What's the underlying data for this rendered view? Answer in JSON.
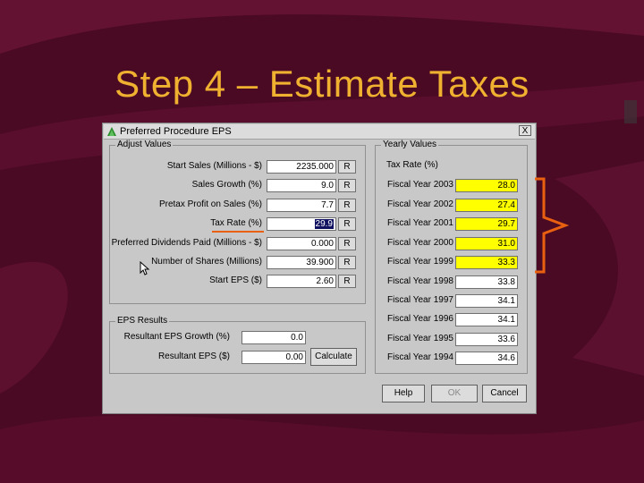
{
  "slide": {
    "title": "Step 4 – Estimate Taxes"
  },
  "window": {
    "title": "Preferred Procedure EPS",
    "close_label": "X"
  },
  "adjust_values": {
    "label": "Adjust Values",
    "rows": [
      {
        "label": "Start Sales (Millions - $)",
        "value": "2235.000",
        "button": "R"
      },
      {
        "label": "Sales Growth (%)",
        "value": "9.0",
        "button": "R"
      },
      {
        "label": "Pretax Profit on Sales (%)",
        "value": "7.7",
        "button": "R"
      },
      {
        "label": "Tax Rate (%)",
        "value": "29.9",
        "button": "R"
      },
      {
        "label": "Preferred Dividends Paid (Millions - $)",
        "value": "0.000",
        "button": "R"
      },
      {
        "label": "Number of Shares (Millions)",
        "value": "39.900",
        "button": "R"
      },
      {
        "label": "Start EPS ($)",
        "value": "2.60",
        "button": "R"
      }
    ]
  },
  "eps_results": {
    "label": "EPS Results",
    "growth_label": "Resultant EPS Growth (%)",
    "growth_value": "0.0",
    "eps_label": "Resultant EPS ($)",
    "eps_value": "0.00",
    "calculate_label": "Calculate"
  },
  "yearly_values": {
    "label": "Yearly Values",
    "header": "Tax Rate (%)",
    "rows": [
      {
        "label": "Fiscal Year 2003",
        "value": "28.0",
        "highlight": true
      },
      {
        "label": "Fiscal Year 2002",
        "value": "27.4",
        "highlight": true
      },
      {
        "label": "Fiscal Year 2001",
        "value": "29.7",
        "highlight": true
      },
      {
        "label": "Fiscal Year 2000",
        "value": "31.0",
        "highlight": true
      },
      {
        "label": "Fiscal Year 1999",
        "value": "33.3",
        "highlight": true
      },
      {
        "label": "Fiscal Year 1998",
        "value": "33.8",
        "highlight": false
      },
      {
        "label": "Fiscal Year 1997",
        "value": "34.1",
        "highlight": false
      },
      {
        "label": "Fiscal Year 1996",
        "value": "34.1",
        "highlight": false
      },
      {
        "label": "Fiscal Year 1995",
        "value": "33.6",
        "highlight": false
      },
      {
        "label": "Fiscal Year 1994",
        "value": "34.6",
        "highlight": false
      }
    ]
  },
  "footer": {
    "help_label": "Help",
    "ok_label": "OK",
    "cancel_label": "Cancel"
  },
  "colors": {
    "title": "#f0b030",
    "background": "#4a0a24",
    "highlight": "#ffff00",
    "annotation": "#e86010"
  }
}
